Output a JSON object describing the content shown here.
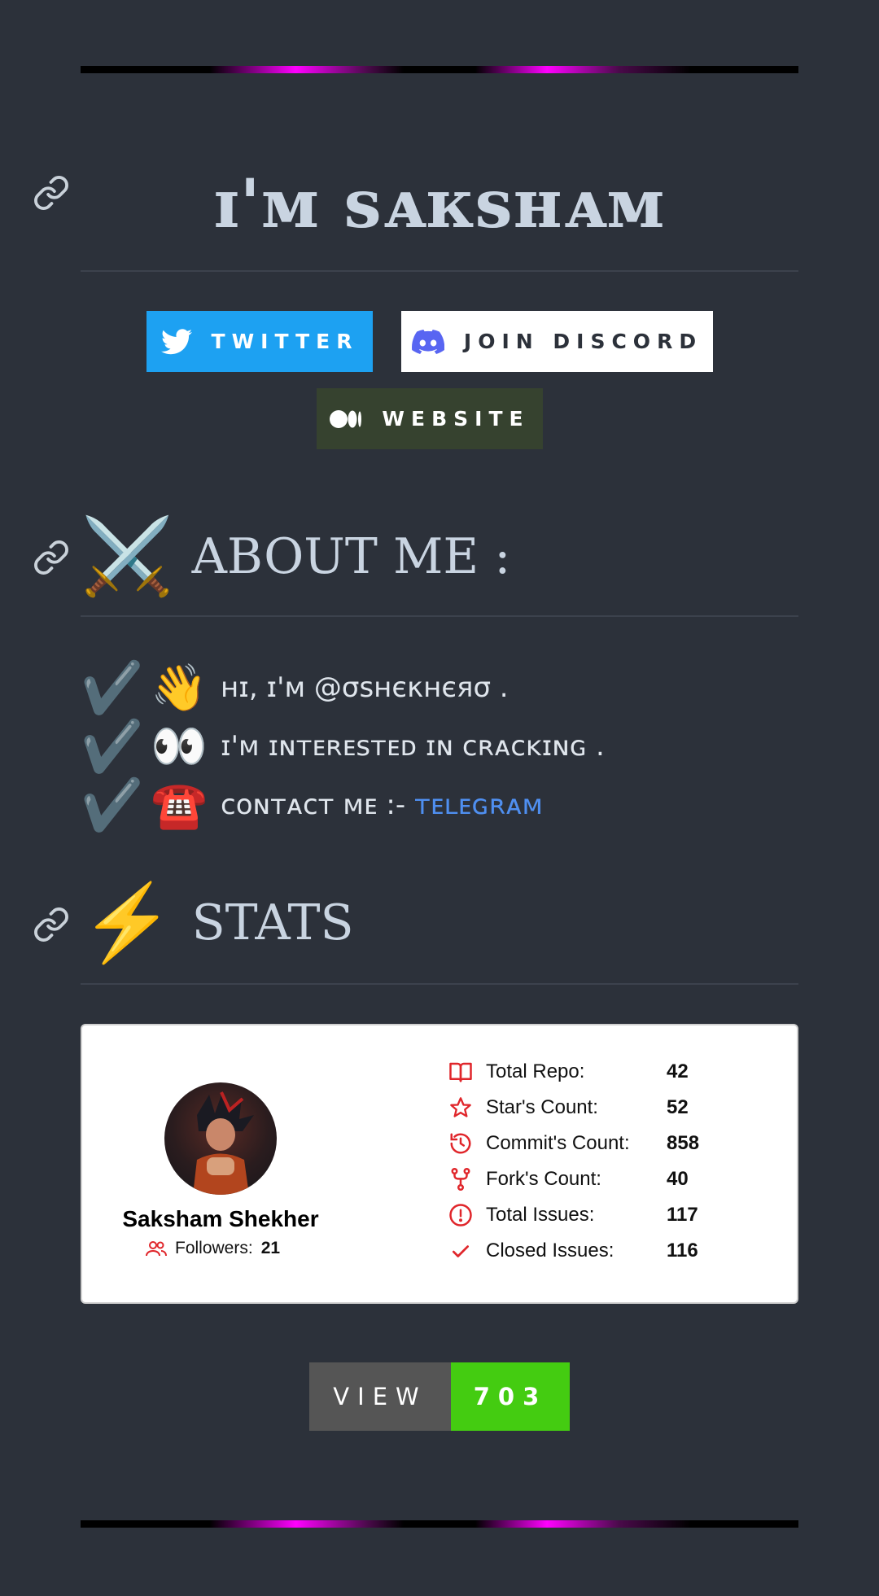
{
  "header": {
    "title": "ɪ'ᴍ sᴀᴋsʜᴀᴍ"
  },
  "buttons": {
    "twitter": "TWITTER",
    "discord": "JOIN DISCORD",
    "website": "WEBSITE"
  },
  "about": {
    "heading": "ABOUT ME :",
    "heading_emoji": "⚔️",
    "lines": [
      {
        "check": "✔️",
        "emoji": "👋",
        "text": "ʜɪ, ɪ'ᴍ @σsнєκнєяσ ."
      },
      {
        "check": "✔️",
        "emoji": "👀",
        "text": "ɪ'ᴍ ɪɴᴛᴇʀᴇsᴛᴇᴅ ɪɴ ᴄʀᴀᴄᴋɪɴɢ ."
      },
      {
        "check": "✔️",
        "emoji": "☎️",
        "text": "ᴄᴏɴᴛᴀᴄᴛ ᴍᴇ :- ",
        "link": "ᴛᴇʟᴇɢʀᴀᴍ"
      }
    ]
  },
  "stats": {
    "heading": "STATS",
    "heading_emoji": "⚡",
    "card": {
      "name": "Saksham Shekher",
      "followers_label": "Followers:",
      "followers": "21",
      "rows": [
        {
          "icon": "book-icon",
          "label": "Total Repo:",
          "value": "42"
        },
        {
          "icon": "star-icon",
          "label": "Star's Count:",
          "value": "52"
        },
        {
          "icon": "history-icon",
          "label": "Commit's Count:",
          "value": "858"
        },
        {
          "icon": "fork-icon",
          "label": "Fork's Count:",
          "value": "40"
        },
        {
          "icon": "issue-icon",
          "label": "Total Issues:",
          "value": "117"
        },
        {
          "icon": "check-icon",
          "label": "Closed Issues:",
          "value": "116"
        }
      ],
      "accent": "#e0262b"
    }
  },
  "view_badge": {
    "label": "VIEW",
    "count": "703"
  },
  "colors": {
    "background": "#2c313a",
    "twitter": "#1da1f2",
    "discord_bg": "#ffffff",
    "website_bg": "#36422f",
    "badge_green": "#44cc11",
    "badge_grey": "#555555"
  }
}
